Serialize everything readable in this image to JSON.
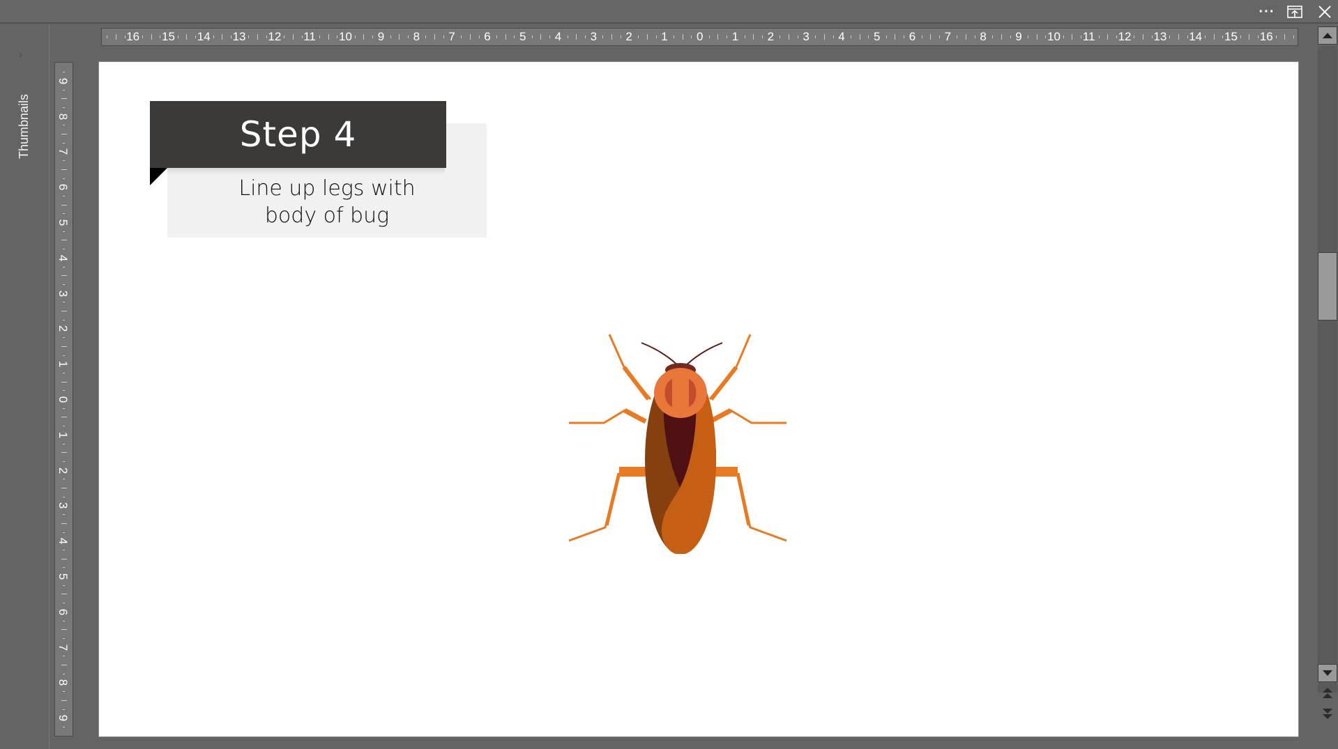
{
  "titlebar": {
    "more_icon": "more-dots-icon",
    "restore_icon": "restore-window-icon",
    "close_icon": "close-icon"
  },
  "thumbnails_pane": {
    "label": "Thumbnails",
    "expand_icon": "chevron-right-icon"
  },
  "rulers": {
    "horizontal_labels": [
      "16",
      "15",
      "14",
      "13",
      "12",
      "11",
      "10",
      "9",
      "8",
      "7",
      "6",
      "5",
      "4",
      "3",
      "2",
      "1",
      "0",
      "1",
      "2",
      "3",
      "4",
      "5",
      "6",
      "7",
      "8",
      "9",
      "10",
      "11",
      "12",
      "13",
      "14",
      "15",
      "16"
    ],
    "vertical_labels": [
      "9",
      "8",
      "7",
      "6",
      "5",
      "4",
      "3",
      "2",
      "1",
      "0",
      "1",
      "2",
      "3",
      "4",
      "5",
      "6",
      "7",
      "8",
      "9"
    ]
  },
  "slide": {
    "step_title": "Step 4",
    "step_description_line1": "Line up legs with",
    "step_description_line2": "body of bug",
    "illustration": "cockroach-illustration",
    "colors": {
      "title_bg": "#3b3a38",
      "desc_bg": "#f1f1f1",
      "leg": "#ea7a22",
      "body_left": "#86400f",
      "body_right": "#c65e14",
      "body_center": "#4e1012",
      "head": "#ea773a",
      "head_marks": "#c24d2c",
      "head_top": "#722a22",
      "antenna": "#5a1a1a"
    }
  },
  "scrollbar": {
    "up_icon": "scroll-up-arrow-icon",
    "down_icon": "scroll-down-arrow-icon",
    "prev_slide_icon": "previous-slide-icon",
    "next_slide_icon": "next-slide-icon",
    "position_fraction": 0.32
  }
}
